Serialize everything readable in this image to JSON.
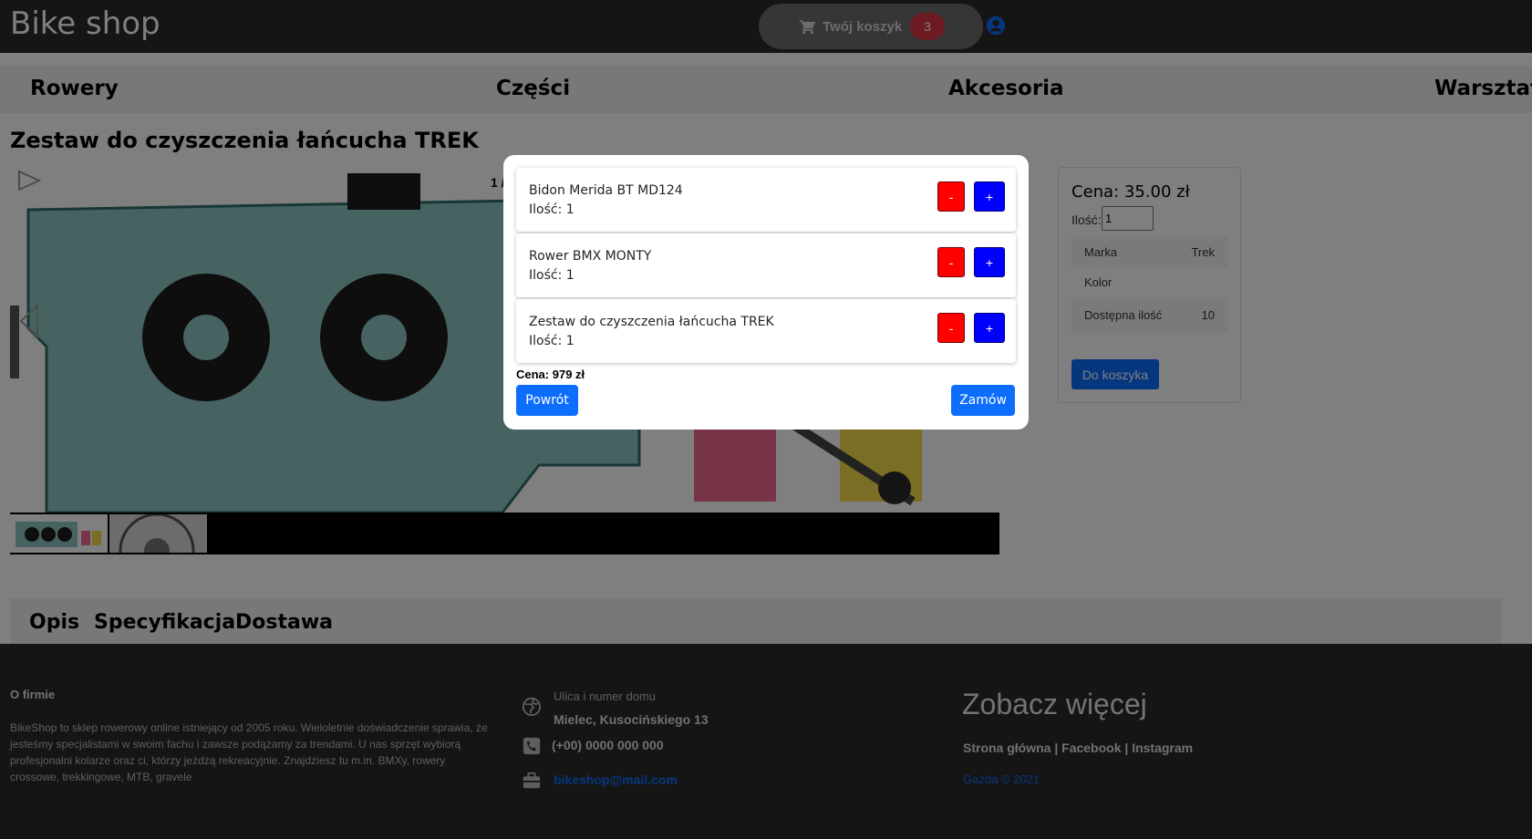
{
  "header": {
    "brand": "Bike shop",
    "cart_label": "Twój koszyk",
    "cart_count": "3",
    "icons": [
      "cart-icon",
      "user-icon"
    ]
  },
  "nav": {
    "items": [
      "Rowery",
      "Części",
      "Akcesoria",
      "Warsztat"
    ]
  },
  "product": {
    "title": "Zestaw do czyszczenia łańcucha TREK",
    "slide_counter": "1 /",
    "price_label": "Cena: 35.00 zł",
    "qty_label": "Ilość:",
    "qty_value": "1",
    "specs": [
      {
        "key": "Marka",
        "value": "Trek"
      },
      {
        "key": "Kolor",
        "value": ""
      },
      {
        "key": "Dostępna ilość",
        "value": "10"
      }
    ],
    "add_to_cart": "Do koszyka"
  },
  "tabs": [
    "Opis",
    "Specyfikacja",
    "Dostawa"
  ],
  "footer": {
    "about_title": "O firmie",
    "about_text": "BikeShop to sklep rowerowy online istniejący od 2005 roku. Wieloletnie doświadczenie sprawia, że jesteśmy specjalistami w swoim fachu i zawsze podążamy za trendami. U nas sprzęt wybiorą profesjonalni kolarze oraz ci, którzy jeżdżą rekreacyjnie. Znajdziesz tu m.in. BMXy, rowery crossowe, trekkingowe, MTB, gravele",
    "street_label": "Ulica i numer domu",
    "street": "Mielec, Kusocińskiego 13",
    "phone": "(+00) 0000 000 000",
    "email": "bikeshop@mail.com",
    "more_title": "Zobacz więcej",
    "links": "Strona główna | Facebook | Instagram",
    "copyright": "Gazda © 2021"
  },
  "modal": {
    "items": [
      {
        "name": "Bidon Merida BT MD124",
        "qty": "Ilość: 1"
      },
      {
        "name": "Rower BMX MONTY",
        "qty": "Ilość: 1"
      },
      {
        "name": "Zestaw do czyszczenia łańcucha TREK",
        "qty": "Ilość: 1"
      }
    ],
    "minus_label": "-",
    "plus_label": "+",
    "total": "Cena: 979 zł",
    "back_label": "Powrót",
    "order_label": "Zamów"
  },
  "colors": {
    "header_bg": "#2a2a2a",
    "primary": "#0d6efd",
    "minus": "#ff0000",
    "plus": "#0000ff",
    "badge": "#dc3545"
  }
}
